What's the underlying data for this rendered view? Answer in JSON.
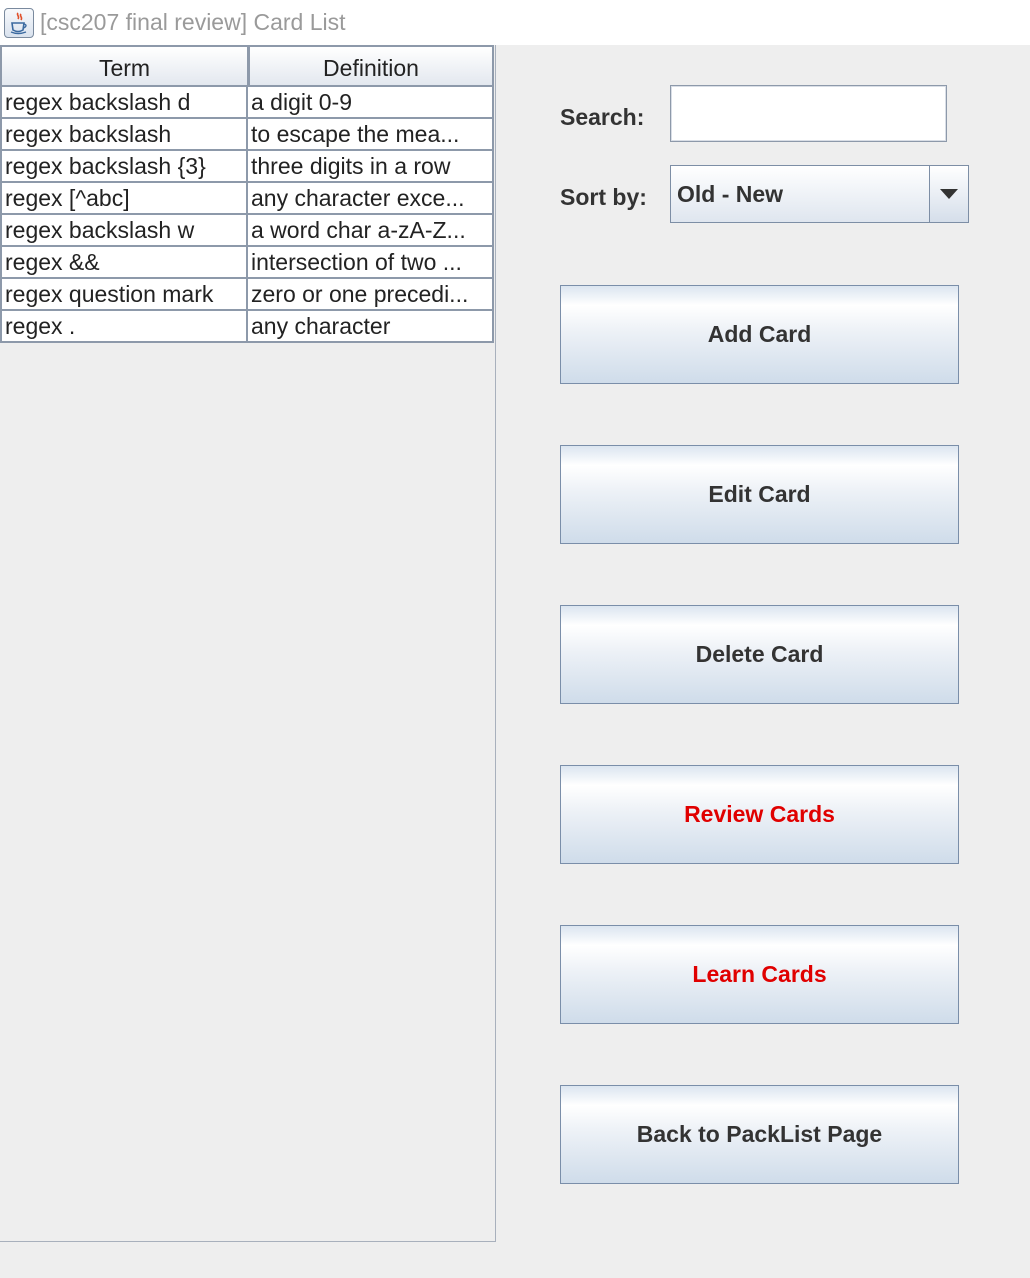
{
  "window": {
    "title": "[csc207 final review] Card List",
    "icon": "java-coffee-cup-icon"
  },
  "table": {
    "columns": [
      "Term",
      "Definition"
    ],
    "rows": [
      [
        "regex backslash d",
        "a digit 0-9"
      ],
      [
        "regex backslash",
        "to escape the mea..."
      ],
      [
        "regex backslash {3}",
        "three digits in a row"
      ],
      [
        "regex [^abc]",
        "any character exce..."
      ],
      [
        "regex backslash w",
        "a word char a-zA-Z..."
      ],
      [
        "regex &&",
        "intersection of two ..."
      ],
      [
        "regex question mark",
        "zero or one precedi..."
      ],
      [
        "regex .",
        "any character"
      ]
    ]
  },
  "search": {
    "label": "Search:",
    "value": ""
  },
  "sort": {
    "label": "Sort by:",
    "selected": "Old - New"
  },
  "buttons": {
    "add": "Add Card",
    "edit": "Edit Card",
    "delete": "Delete Card",
    "review": "Review Cards",
    "learn": "Learn Cards",
    "back": "Back to PackList Page"
  },
  "colors": {
    "highlight_text": "#e00000",
    "normal_text": "#333333"
  }
}
